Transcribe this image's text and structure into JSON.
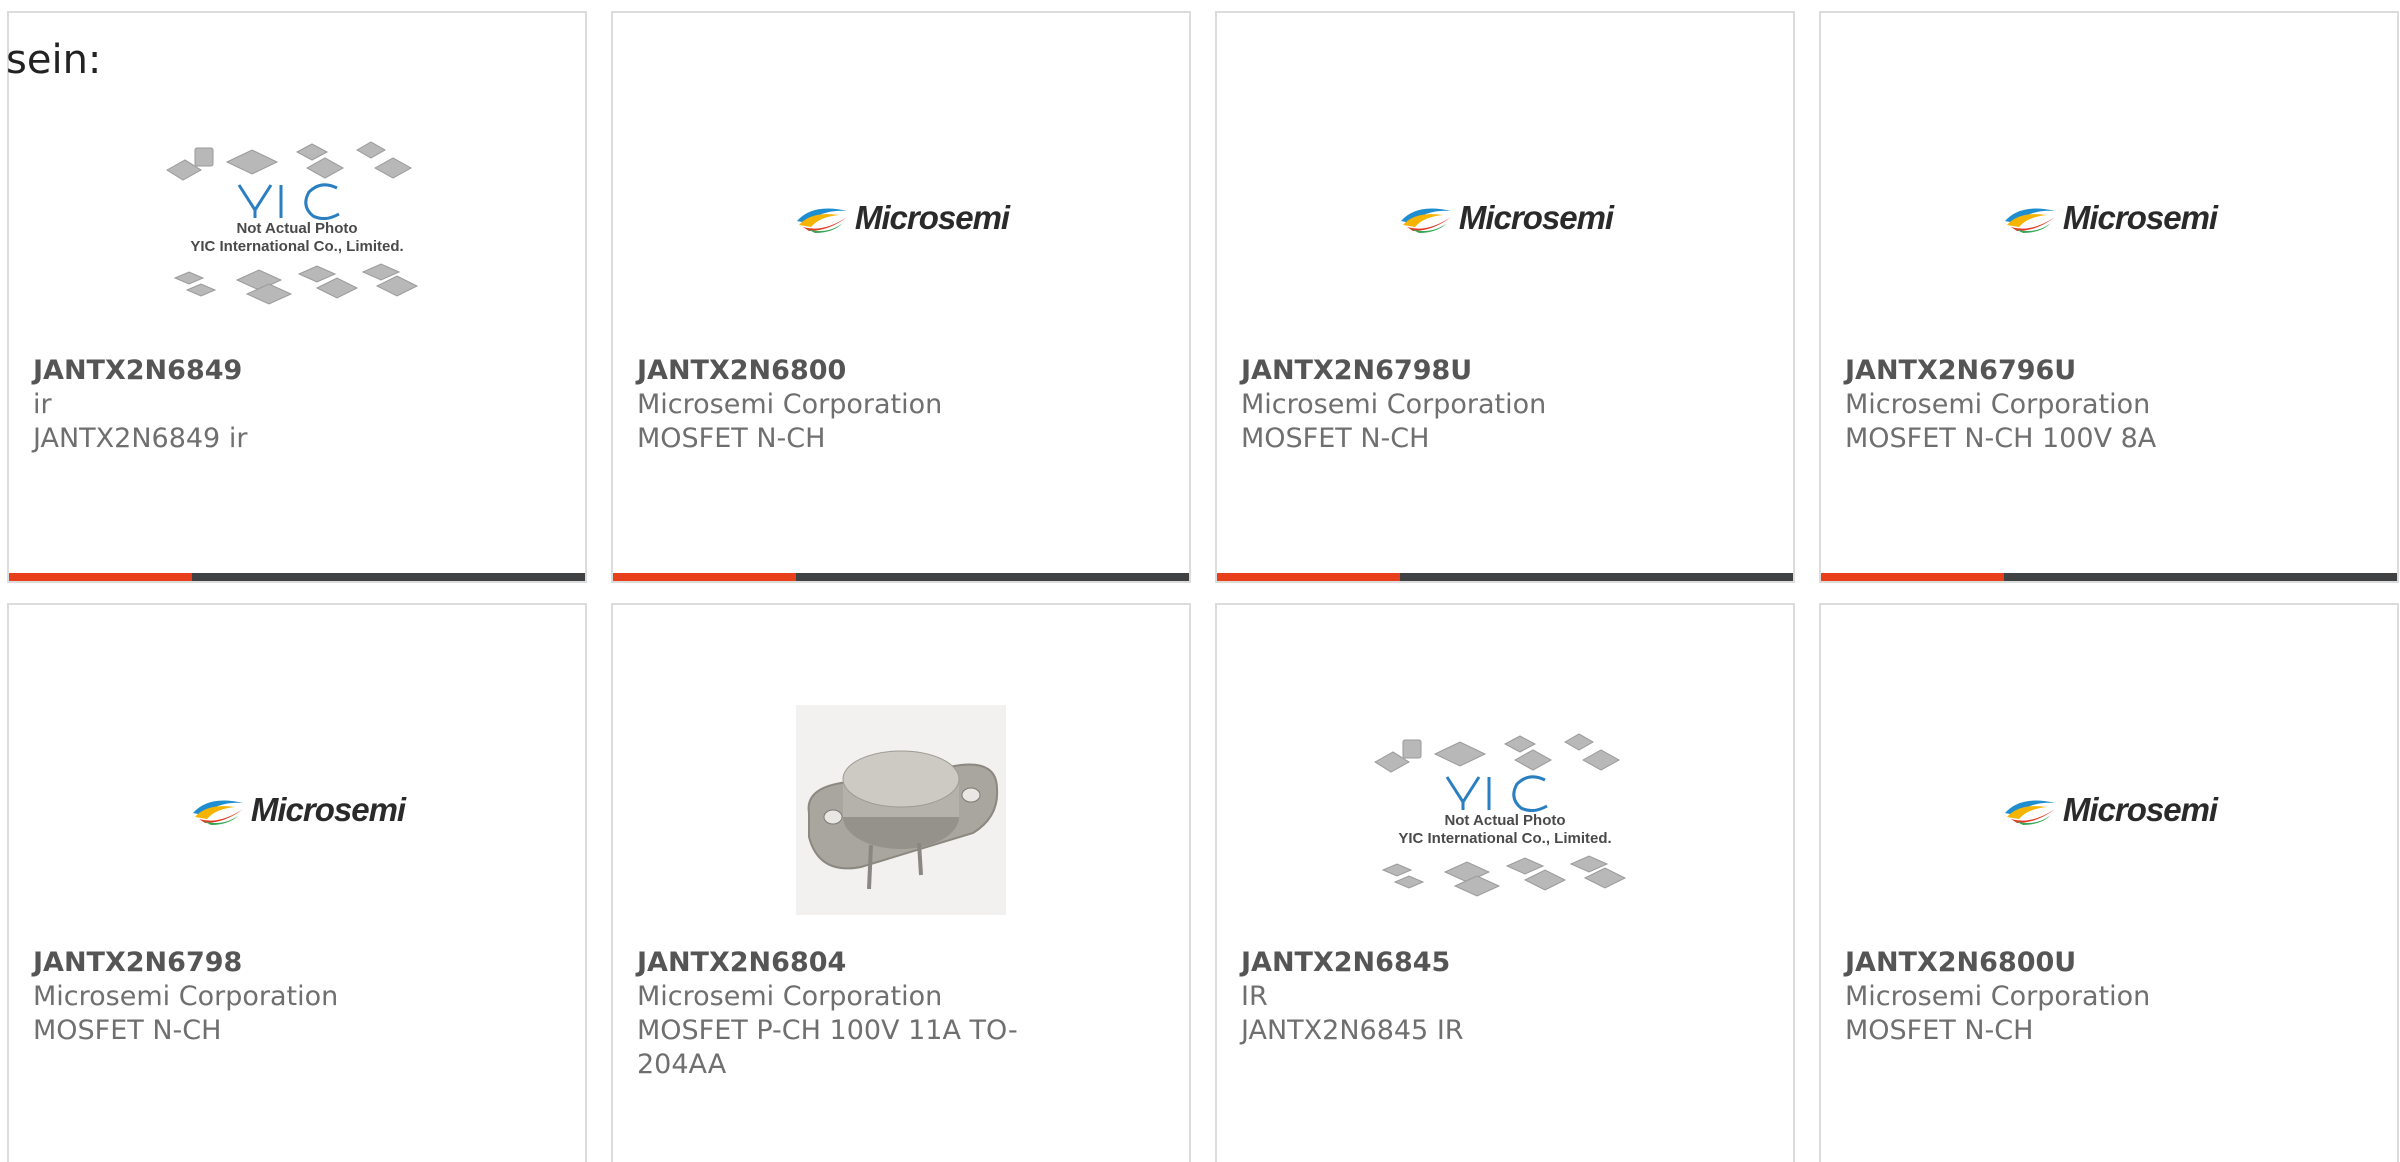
{
  "intro_text": "sein:",
  "colors": {
    "accent": "#e8401c",
    "bar": "#3f4143",
    "border": "#dcdcdc"
  },
  "cards": [
    {
      "part_number": "JANTX2N6849",
      "manufacturer": "ir",
      "description": "JANTX2N6849 ir",
      "image": "yic-placeholder",
      "image_caption_1": "Not Actual Photo",
      "image_caption_2": "YIC International Co., Limited."
    },
    {
      "part_number": "JANTX2N6800",
      "manufacturer": "Microsemi Corporation",
      "description": "MOSFET N-CH",
      "image": "microsemi-logo",
      "logo_text": "Microsemi"
    },
    {
      "part_number": "JANTX2N6798U",
      "manufacturer": "Microsemi Corporation",
      "description": "MOSFET N-CH",
      "image": "microsemi-logo",
      "logo_text": "Microsemi"
    },
    {
      "part_number": "JANTX2N6796U",
      "manufacturer": "Microsemi Corporation",
      "description": "MOSFET N-CH 100V 8A",
      "image": "microsemi-logo",
      "logo_text": "Microsemi"
    },
    {
      "part_number": "JANTX2N6798",
      "manufacturer": "Microsemi Corporation",
      "description": "MOSFET N-CH",
      "image": "microsemi-logo",
      "logo_text": "Microsemi"
    },
    {
      "part_number": "JANTX2N6804",
      "manufacturer": "Microsemi Corporation",
      "description": "MOSFET P-CH 100V 11A TO-204AA",
      "image": "to-204aa-package-photo"
    },
    {
      "part_number": "JANTX2N6845",
      "manufacturer": "IR",
      "description": "JANTX2N6845 IR",
      "image": "yic-placeholder",
      "image_caption_1": "Not Actual Photo",
      "image_caption_2": "YIC International Co., Limited."
    },
    {
      "part_number": "JANTX2N6800U",
      "manufacturer": "Microsemi Corporation",
      "description": "MOSFET N-CH",
      "image": "microsemi-logo",
      "logo_text": "Microsemi"
    }
  ]
}
